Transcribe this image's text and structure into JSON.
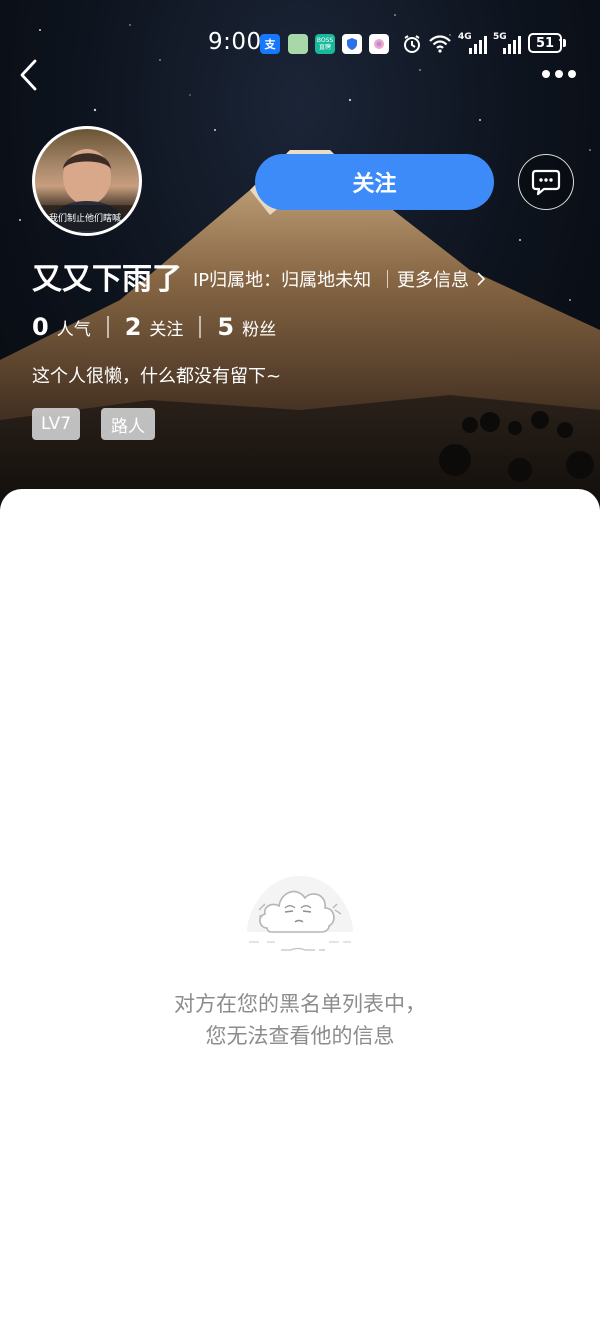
{
  "status_bar": {
    "time": "9:00",
    "network_1": "4G",
    "network_2": "5G",
    "battery": "51",
    "app_icons": [
      "alipay-icon",
      "app-icon",
      "boss-icon",
      "shield-app-icon",
      "photos-icon"
    ],
    "boss_label": "BOSS 直聘"
  },
  "nav": {
    "back_icon": "chevron-left-icon",
    "more_icon": "more-dots-icon"
  },
  "profile": {
    "name": "又又下雨了",
    "ip_location": "IP归属地：归属地未知",
    "more_info": "更多信息",
    "avatar_caption": "我们制止他们瞎喊",
    "stats": [
      {
        "value": "0",
        "label": "人气"
      },
      {
        "value": "2",
        "label": "关注"
      },
      {
        "value": "5",
        "label": "粉丝"
      }
    ],
    "bio": "这个人很懒，什么都没有留下~",
    "tags": [
      "LV7",
      "路人"
    ]
  },
  "actions": {
    "follow_label": "关注",
    "follow_color": "#3d8bf8",
    "message_icon": "chat-bubble-icon"
  },
  "empty_state": {
    "illustration": "cloud-icon",
    "line1": "对方在您的黑名单列表中，",
    "line2": "您无法查看他的信息"
  }
}
